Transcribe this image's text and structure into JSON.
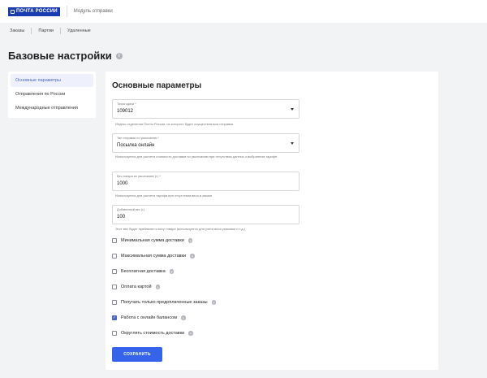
{
  "header": {
    "logo_text": "ПОЧТА РОССИИ",
    "module_title": "Модуль отправки"
  },
  "nav_tabs": [
    "Заказы",
    "Партии",
    "Удаленные"
  ],
  "page": {
    "title": "Базовые настройки"
  },
  "sidebar": {
    "items": [
      {
        "label": "Основные параметры",
        "active": true
      },
      {
        "label": "Отправления по России",
        "active": false
      },
      {
        "label": "Международные отправления",
        "active": false
      }
    ]
  },
  "main": {
    "section_title": "Основные параметры",
    "fields": {
      "point": {
        "label": "Точка сдачи *",
        "value": "109012",
        "hint": "Индекс отделения Почты России, из которого будет осуществляться отправка"
      },
      "type": {
        "label": "Тип отправки по умолчанию *",
        "value": "Посылка онлайн",
        "hint": "Используется для расчета стоимости доставки по умолчанию при отсутствии данных о выбранном тарифе"
      },
      "weight": {
        "label": "Вес товара по умолчанию (г.) *",
        "value": "1000",
        "hint": "Используется для расчета тарифа при отсутствии веса в заказе"
      },
      "extra_weight": {
        "label": "Добавочный вес (г.)",
        "value": "100",
        "hint": "Этот вес будет прибавлен к весу товара (используется для учета веса упаковки и т.д.)"
      }
    },
    "checkboxes": [
      {
        "label": "Минимальная сумма доставки",
        "checked": false
      },
      {
        "label": "Максимальная сумма доставки",
        "checked": false
      },
      {
        "label": "Бесплатная доставка",
        "checked": false
      },
      {
        "label": "Оплата картой",
        "checked": false
      },
      {
        "label": "Получать только предоплаченные заказы",
        "checked": false
      },
      {
        "label": "Работа с онлайн балансом",
        "checked": true
      },
      {
        "label": "Округлять стоимость доставки",
        "checked": false
      }
    ],
    "save_label": "СОХРАНИТЬ"
  },
  "colors": {
    "accent": "#3563e9",
    "logo": "#1a3cb3",
    "sidebar_active_bg": "#eef1fb"
  }
}
